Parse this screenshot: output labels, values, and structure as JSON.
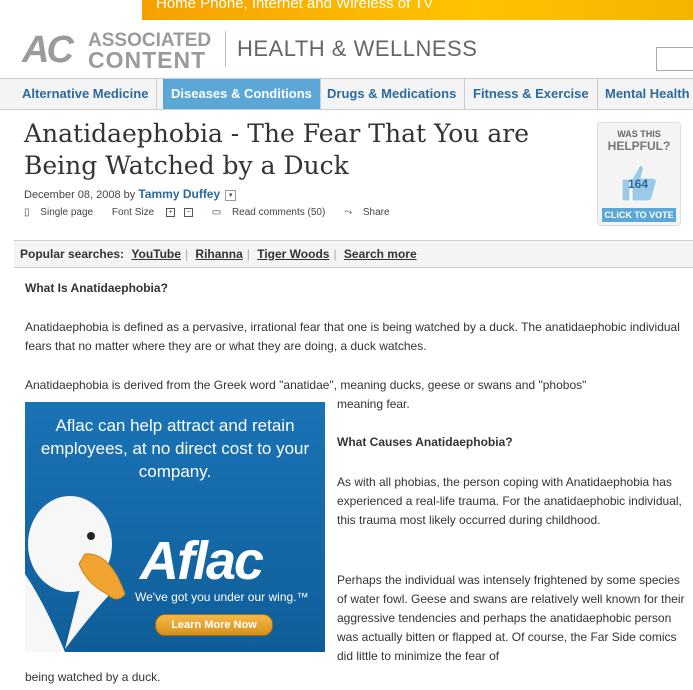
{
  "top_ad": {
    "text": "Home Phone, Internet and Wireless of TV"
  },
  "header": {
    "logo_ac": "AC",
    "logo_line1": "ASSOCIATED",
    "logo_line2": "CONTENT",
    "section": "HEALTH & WELLNESS"
  },
  "nav": {
    "items": [
      {
        "label": "Alternative Medicine"
      },
      {
        "label": "Diseases & Conditions"
      },
      {
        "label": "Drugs & Medications"
      },
      {
        "label": "Fitness & Exercise"
      },
      {
        "label": "Mental Health"
      }
    ]
  },
  "article": {
    "title": "Anatidaephobia - The Fear That You are Being Watched by a Duck",
    "date": "December 08, 2008 by",
    "author": "Tammy Duffey",
    "tools": {
      "single_page": "Single page",
      "font_size": "Font Size",
      "read_comments": "Read comments (50)",
      "share": "Share"
    },
    "h1": "What Is Anatidaephobia?",
    "p1": "Anatidaephobia is defined as a pervasive, irrational fear that one is being watched by a duck. The anatidaephobic individual fears that no matter where they are or what they are doing, a duck watches.",
    "p2": "Anatidaephobia is derived from the Greek word \"anatidae\", meaning ducks, geese or swans and \"phobos\"",
    "p2b": "meaning fear.",
    "h2": "What Causes Anatidaephobia?",
    "p3": "As with all phobias, the person coping with Anatidaephobia has experienced a real-life trauma. For the anatidaephobic individual, this trauma most likely occurred during childhood.",
    "p4": "Perhaps the individual was intensely frightened by some species of water fowl. Geese and swans are relatively well known for their aggressive tendencies and perhaps the anatidaephobic person was actually bitten or flapped at. Of course, the Far Side comics did little to minimize the fear of",
    "p4b": "being watched by a duck."
  },
  "vote": {
    "q1": "WAS THIS",
    "q2": "HELPFUL?",
    "count": "164",
    "cta": "CLICK TO VOTE"
  },
  "popular": {
    "label": "Popular searches:",
    "links": [
      "YouTube",
      "Rihanna",
      "Tiger Woods",
      "Search more"
    ]
  },
  "ad": {
    "headline": "Aflac can help attract and retain employees, at no direct cost to your company.",
    "brand": "Aflac",
    "tagline": "We've got you under our wing.™",
    "button": "Learn More Now"
  },
  "colors": {
    "link": "#2a6aa0",
    "nav_active": "#5aa7d8",
    "ad_blue": "#1a73b5"
  }
}
